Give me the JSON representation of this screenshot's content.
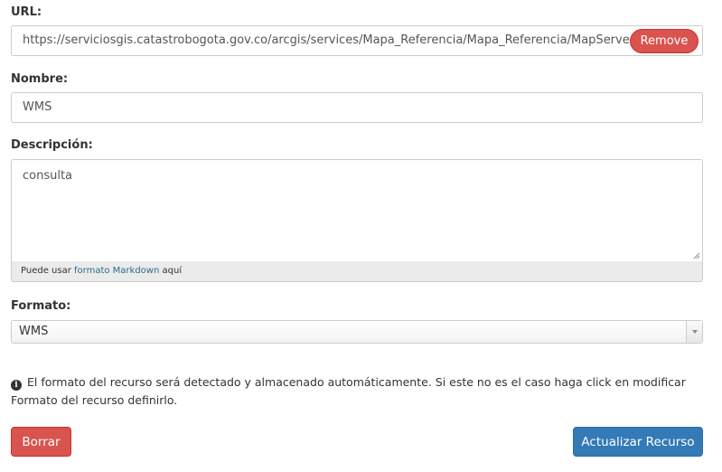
{
  "url": {
    "label": "URL:",
    "value": "https://serviciosgis.catastrobogota.gov.co/arcgis/services/Mapa_Referencia/Mapa_Referencia/MapServer/\\",
    "remove_label": "Remove"
  },
  "nombre": {
    "label": "Nombre:",
    "value": "WMS"
  },
  "descripcion": {
    "label": "Descripción:",
    "value": "consulta",
    "hint_prefix": "Puede usar",
    "hint_link": "formato Markdown",
    "hint_suffix": "aquí"
  },
  "formato": {
    "label": "Formato:",
    "selected": "WMS"
  },
  "info": {
    "icon": "info-circle-icon",
    "text": "El formato del recurso será detectado y almacenado automáticamente. Si este no es el caso haga click en modificar Formato del recurso definirlo."
  },
  "actions": {
    "delete_label": "Borrar",
    "update_label": "Actualizar Recurso"
  },
  "colors": {
    "danger": "#d9534f",
    "primary": "#337ab7",
    "link": "#2c6b8a"
  }
}
